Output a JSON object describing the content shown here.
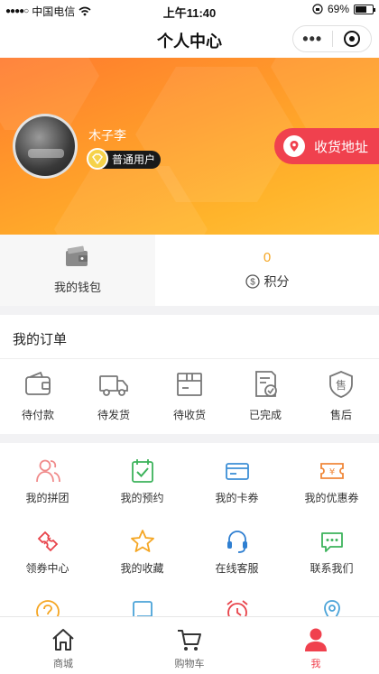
{
  "status_bar": {
    "carrier": "中国电信",
    "time": "上午11:40",
    "battery_percent": "69%",
    "battery_level": 0.69
  },
  "nav": {
    "title": "个人中心",
    "more_label": "•••"
  },
  "profile": {
    "name": "木子李",
    "badge": "普通用户",
    "address_button": "收货地址"
  },
  "assets": {
    "wallet_label": "我的钱包",
    "points_value": "0",
    "points_label": "积分"
  },
  "orders": {
    "title": "我的订单",
    "items": [
      {
        "label": "待付款",
        "icon": "wallet-icon"
      },
      {
        "label": "待发货",
        "icon": "truck-icon"
      },
      {
        "label": "待收货",
        "icon": "package-icon"
      },
      {
        "label": "已完成",
        "icon": "document-check-icon"
      },
      {
        "label": "售后",
        "icon": "shield-sale-icon"
      }
    ]
  },
  "services": {
    "items": [
      {
        "label": "我的拼团",
        "icon": "group-icon",
        "color": "#f08a8a"
      },
      {
        "label": "我的预约",
        "icon": "calendar-check-icon",
        "color": "#3cb35b"
      },
      {
        "label": "我的卡券",
        "icon": "card-icon",
        "color": "#3d8fd6"
      },
      {
        "label": "我的优惠券",
        "icon": "coupon-yuan-icon",
        "color": "#f0883a"
      },
      {
        "label": "领券中心",
        "icon": "ticket-icon",
        "color": "#e8434a"
      },
      {
        "label": "我的收藏",
        "icon": "star-icon",
        "color": "#f5a623"
      },
      {
        "label": "在线客服",
        "icon": "headset-icon",
        "color": "#2f7fd1"
      },
      {
        "label": "联系我们",
        "icon": "chat-icon",
        "color": "#3cb35b"
      },
      {
        "label": "",
        "icon": "help-icon",
        "color": "#f5a623"
      },
      {
        "label": "",
        "icon": "image-card-icon",
        "color": "#4aa3d8"
      },
      {
        "label": "",
        "icon": "alarm-icon",
        "color": "#e8434a"
      },
      {
        "label": "",
        "icon": "location-icon",
        "color": "#4aa3d8"
      }
    ]
  },
  "tabs": [
    {
      "label": "商城",
      "icon": "home-icon"
    },
    {
      "label": "购物车",
      "icon": "cart-icon"
    },
    {
      "label": "我",
      "icon": "user-icon",
      "active": true
    }
  ],
  "colors": {
    "brand_red": "#f0414e",
    "banner_orange": "#ff8a2a",
    "points_orange": "#f5a623"
  }
}
